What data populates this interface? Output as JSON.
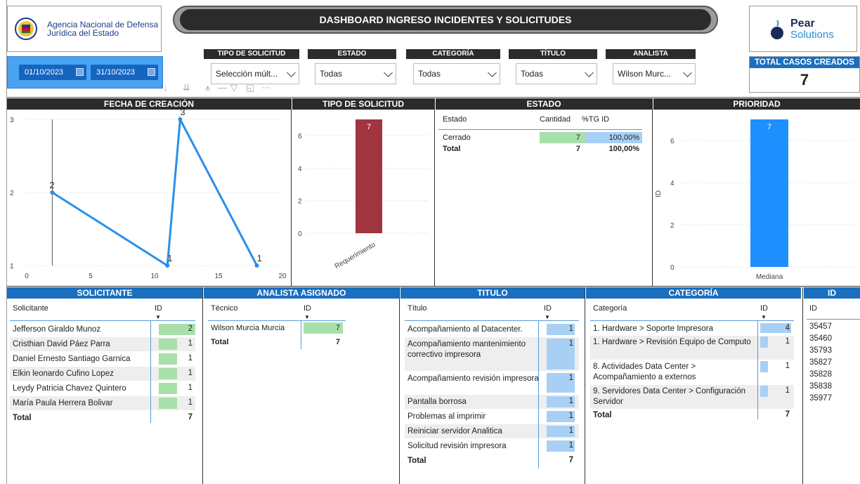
{
  "header": {
    "title": "DASHBOARD INGRESO INCIDENTES Y SOLICITUDES",
    "agency_line1": "Agencia Nacional de Defensa",
    "agency_line2": "Jurídica del Estado",
    "pear_name": "Pear",
    "pear_sub": "Solutions"
  },
  "dates": {
    "from": "01/10/2023",
    "to": "31/10/2023"
  },
  "slicers": [
    {
      "label": "TIPO DE SOLICITUD",
      "value": "Selección múlt..."
    },
    {
      "label": "ESTADO",
      "value": "Todas"
    },
    {
      "label": "CATEGORÍA",
      "value": "Todas"
    },
    {
      "label": "TÍTULO",
      "value": "Todas"
    },
    {
      "label": "ANALISTA",
      "value": "Wilson Murc..."
    }
  ],
  "total_cases": {
    "label": "TOTAL CASOS CREADOS",
    "value": "7"
  },
  "fecha_creacion": {
    "title": "FECHA DE CREACIÓN",
    "chart_data": {
      "type": "line",
      "x": [
        2,
        11,
        12,
        18
      ],
      "y": [
        2,
        1,
        3,
        1
      ],
      "labels": [
        "2",
        "1",
        "3",
        "1"
      ],
      "xticks": [
        "0",
        "5",
        "10",
        "15",
        "20"
      ],
      "yticks": [
        "1",
        "2",
        "3"
      ],
      "xlim": [
        0,
        20
      ],
      "ylim": [
        1,
        3
      ]
    }
  },
  "tipo_solicitud": {
    "title": "TIPO DE SOLICITUD",
    "chart_data": {
      "type": "bar",
      "categories": [
        "Requerimiento"
      ],
      "values": [
        7
      ],
      "yticks": [
        "0",
        "2",
        "4",
        "6"
      ],
      "ylim": [
        0,
        7
      ],
      "color": "#a0343f"
    }
  },
  "estado": {
    "title": "ESTADO",
    "columns": [
      "Estado",
      "Cantidad",
      "%TG ID"
    ],
    "rows": [
      {
        "estado": "Cerrado",
        "cantidad": "7",
        "pct": "100,00%"
      }
    ],
    "total": {
      "label": "Total",
      "cantidad": "7",
      "pct": "100,00%"
    }
  },
  "prioridad": {
    "title": "PRIORIDAD",
    "chart_data": {
      "type": "bar",
      "categories": [
        "Mediana"
      ],
      "values": [
        7
      ],
      "ylabel": "ID",
      "yticks": [
        "0",
        "2",
        "4",
        "6"
      ],
      "ylim": [
        0,
        7
      ],
      "color": "#1e8fff"
    }
  },
  "solicitante": {
    "title": "SOLICITANTE",
    "columns": [
      "Solicitante",
      "ID"
    ],
    "rows": [
      {
        "name": "Jefferson Giraldo Munoz",
        "id": "2",
        "frac": 1.0
      },
      {
        "name": "Cristhian David Páez Parra",
        "id": "1",
        "frac": 0.5
      },
      {
        "name": "Daniel Ernesto Santiago Garnica",
        "id": "1",
        "frac": 0.5
      },
      {
        "name": "Elkin leonardo Cufino Lopez",
        "id": "1",
        "frac": 0.5
      },
      {
        "name": "Leydy Patricia Chavez Quintero",
        "id": "1",
        "frac": 0.5
      },
      {
        "name": "María Paula Herrera Bolivar",
        "id": "1",
        "frac": 0.5
      }
    ],
    "total": {
      "label": "Total",
      "id": "7"
    }
  },
  "analista": {
    "title": "ANALISTA ASIGNADO",
    "columns": [
      "Técnico",
      "ID"
    ],
    "rows": [
      {
        "name": "Wilson Murcia Murcia",
        "id": "7",
        "frac": 1.0
      }
    ],
    "total": {
      "label": "Total",
      "id": "7"
    }
  },
  "titulo": {
    "title": "TITULO",
    "columns": [
      "Título",
      "ID"
    ],
    "rows": [
      {
        "name": "Acompañamiento al Datacenter.",
        "id": "1"
      },
      {
        "name": "Acompañamiento mantenimiento correctivo impresora",
        "id": "1"
      },
      {
        "name": "Acompañamiento revisión impresora",
        "id": "1"
      },
      {
        "name": "Pantalla borrosa",
        "id": "1"
      },
      {
        "name": "Problemas al imprimir",
        "id": "1"
      },
      {
        "name": "Reiniciar servidor Analitica",
        "id": "1"
      },
      {
        "name": "Solicitud revisión impresora",
        "id": "1"
      }
    ],
    "total": {
      "label": "Total",
      "id": "7"
    }
  },
  "categoria": {
    "title": "CATEGORÍA",
    "columns": [
      "Categoría",
      "ID"
    ],
    "rows": [
      {
        "name": "1. Hardware > Soporte Impresora",
        "id": "4",
        "frac": 1.0
      },
      {
        "name": "1. Hardware > Revisión Equipo de Computo",
        "id": "1",
        "frac": 0.25
      },
      {
        "name": "8. Actividades Data Center > Acompañamiento a externos",
        "id": "1",
        "frac": 0.25
      },
      {
        "name": "9. Servidores Data Center > Configuración Servidor",
        "id": "1",
        "frac": 0.25
      }
    ],
    "total": {
      "label": "Total",
      "id": "7"
    }
  },
  "id_table": {
    "title": "ID",
    "column": "ID",
    "rows": [
      "35457",
      "35460",
      "35793",
      "35827",
      "35828",
      "35838",
      "35977"
    ]
  }
}
